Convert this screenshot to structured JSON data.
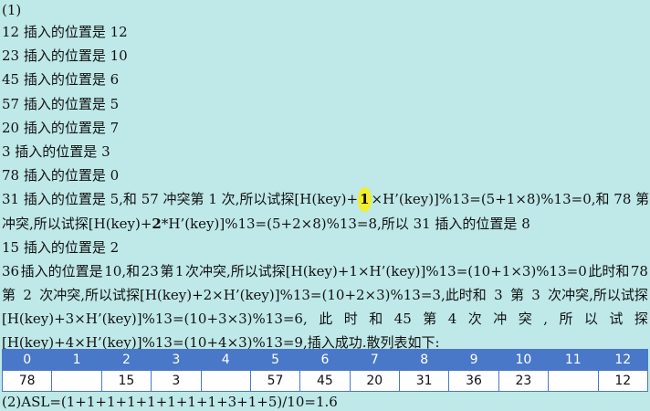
{
  "part1_label": "(1)",
  "lines": [
    "12 插入的位置是 12",
    "23 插入的位置是 10",
    "45 插入的位置是 6",
    "57 插入的位置是 5",
    "20 插入的位置是 7",
    "3 插入的位置是 3",
    "78 插入的位置是 0"
  ],
  "line31": {
    "prefix": "31 插入的位置是 5,和 57 冲突第 1 次,所以试探[H(key)+",
    "hl": "1",
    "suffix": "×H’(key)]%13=(5+1×8)%13=0,和 78 第 2 次",
    "cont_prefix": "冲突,所以试探[H(key)+",
    "cont_bold": "2",
    "cont_suffix": "*H’(key)]%13=(5+2×8)%13=8,所以 31 插入的位置是 8"
  },
  "line15": "15 插入的位置是 2",
  "line36": {
    "a": [
      "36",
      "插入的位置是",
      "10,和",
      "23",
      "第",
      "1",
      "次冲突,所以试探[H(key)+1×H’(key)]%13=(10+1×3)%13=0",
      "此时和",
      "78"
    ],
    "b": [
      "第",
      "2",
      "次冲突,所以试探[H(key)+2×H’(key)]%13=(10+2×3)%13=3,此时和",
      "3",
      "第",
      "3",
      "次冲突,所以试探"
    ],
    "c": [
      "[H(key)+3×H’(key)]%13=(10+3×3)%13=6,",
      "此",
      "时",
      "和",
      "45",
      "第",
      "4",
      "次",
      "冲",
      "突",
      ",",
      "所",
      "以",
      "试",
      "探"
    ],
    "d": "[H(key)+4×H’(key)]%13=(10+4×3)%13=9,插入成功.散列表如下:"
  },
  "table": {
    "headers": [
      "0",
      "1",
      "2",
      "3",
      "4",
      "5",
      "6",
      "7",
      "8",
      "9",
      "10",
      "11",
      "12"
    ],
    "values": [
      "78",
      "",
      "15",
      "3",
      "",
      "57",
      "45",
      "20",
      "31",
      "36",
      "23",
      "",
      "12"
    ]
  },
  "asl": "(2)ASL=(1+1+1+1+1+1+1+1+3+1+5)/10=1.6"
}
